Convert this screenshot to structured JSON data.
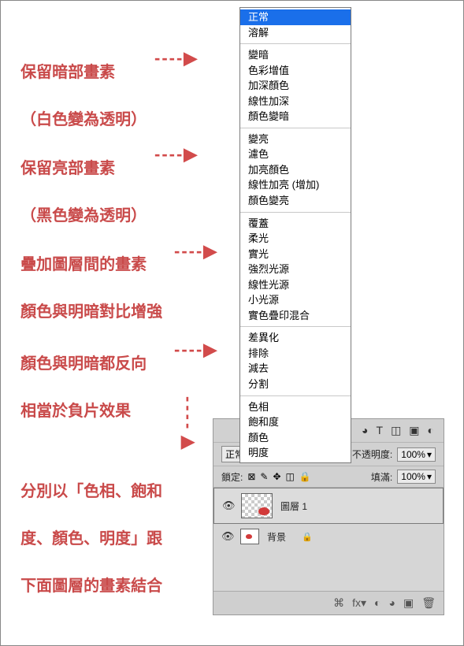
{
  "annotations": {
    "a1_line1": "保留暗部畫素",
    "a1_line2": "（白色變為透明）",
    "a2_line1": "保留亮部畫素",
    "a2_line2": "（黑色變為透明）",
    "a3_line1": "疊加圖層間的畫素",
    "a3_line2": "顏色與明暗對比增強",
    "a4_line1": "顏色與明暗都反向",
    "a4_line2": "相當於負片效果",
    "a5_line1": "分別以「色相、飽和",
    "a5_line2": "度、顏色、明度」跟",
    "a5_line3": "下面圖層的畫素結合"
  },
  "arrows": {
    "dash_right": "----▶",
    "dash_down": "----▶"
  },
  "menu": {
    "g1": [
      "正常",
      "溶解"
    ],
    "g2": [
      "變暗",
      "色彩增值",
      "加深顏色",
      "線性加深",
      "顏色變暗"
    ],
    "g3": [
      "變亮",
      "濾色",
      "加亮顏色",
      "線性加亮 (增加)",
      "顏色變亮"
    ],
    "g4": [
      "覆蓋",
      "柔光",
      "實光",
      "強烈光源",
      "線性光源",
      "小光源",
      "實色疊印混合"
    ],
    "g5": [
      "差異化",
      "排除",
      "減去",
      "分割"
    ],
    "g6": [
      "色相",
      "飽和度",
      "顏色",
      "明度"
    ],
    "selected": "正常"
  },
  "panel": {
    "mode_label": "正常",
    "opacity_label": "不透明度:",
    "opacity_value": "100%",
    "lock_label": "鎖定:",
    "fill_label": "填滿:",
    "fill_value": "100%",
    "layer1": "圖層 1",
    "background": "背景",
    "icons_top": [
      "◕",
      "T",
      "◫",
      "▣",
      "◐"
    ],
    "lock_icons": [
      "⊠",
      "✎",
      "✥",
      "◫",
      "🔒"
    ],
    "foot_icons": [
      "⌘",
      "fx▾",
      "◐",
      "◕",
      "▣",
      "🗑"
    ]
  }
}
